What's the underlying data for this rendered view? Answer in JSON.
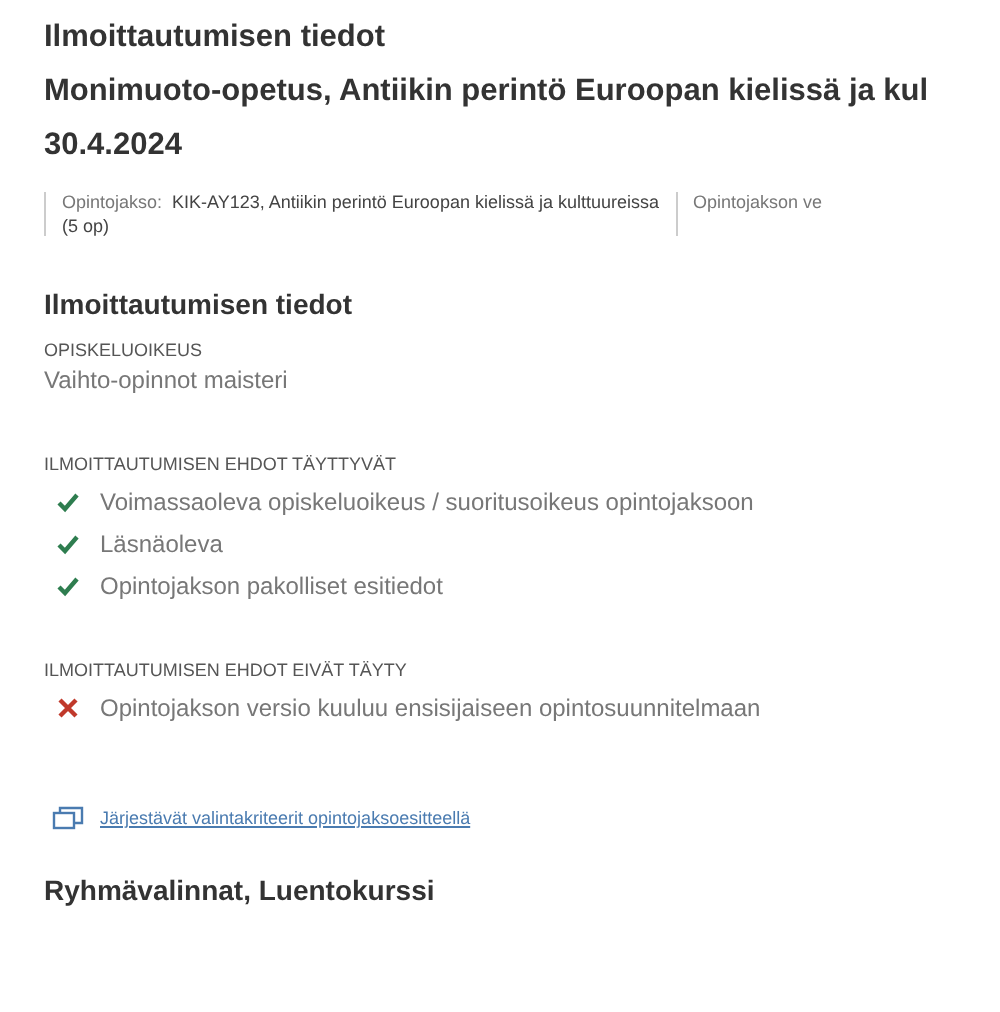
{
  "header": {
    "title": "Ilmoittautumisen tiedot",
    "course_title": "Monimuoto-opetus, Antiikin perintö Euroopan kielissä ja kul",
    "date": "30.4.2024"
  },
  "info_bar": [
    {
      "label": "Opintojakso:",
      "value": "KIK-AY123, Antiikin perintö Euroopan kielissä ja kulttuureissa",
      "extra": "(5 op)"
    },
    {
      "label": "Opintojakson ve"
    }
  ],
  "section": {
    "title": "Ilmoittautumisen tiedot",
    "right_label": "OPISKELUOIKEUS",
    "right_value": "Vaihto-opinnot maisteri"
  },
  "condition_groups": [
    {
      "title": "ILMOITTAUTUMISEN EHDOT TÄYTTYVÄT",
      "items": [
        {
          "text": "Voimassaoleva opiskeluoikeus / suoritusoikeus opintojaksoon",
          "met": true
        },
        {
          "text": "Läsnäoleva",
          "met": true
        },
        {
          "text": "Opintojakson pakolliset esitiedot",
          "met": true
        }
      ]
    },
    {
      "title": "ILMOITTAUTUMISEN EHDOT EIVÄT TÄYTY",
      "items": [
        {
          "text": "Opintojakson versio kuuluu ensisijaiseen opintosuunnitelmaan",
          "met": false
        }
      ]
    }
  ],
  "link": {
    "text": "Järjestävät valintakriteerit opintojaksoesitteellä"
  },
  "next_section": {
    "title": "Ryhmävalinnat, Luentokurssi"
  }
}
